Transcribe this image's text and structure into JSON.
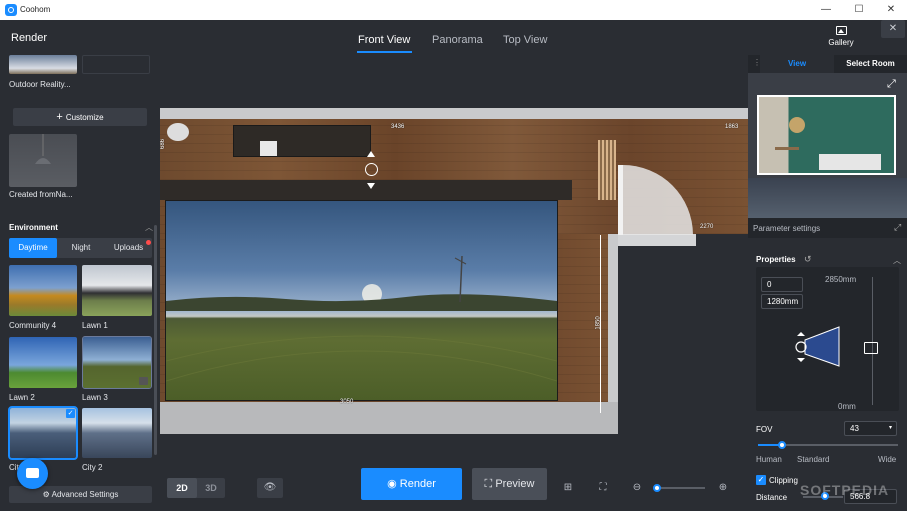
{
  "titlebar": {
    "title": "Coohom",
    "minimize": "—",
    "maximize": "☐",
    "close": "✕"
  },
  "header": {
    "title": "Render",
    "tabs": [
      {
        "label": "Front View"
      },
      {
        "label": "Panorama"
      },
      {
        "label": "Top View"
      }
    ],
    "gallery_label": "Gallery",
    "close": "✕"
  },
  "left": {
    "outdoor_label": "Outdoor Reality...",
    "customize_label": "Customize",
    "created_label": "Created fromNa...",
    "environment_title": "Environment",
    "env_tabs": [
      "Daytime",
      "Night",
      "Uploads"
    ],
    "thumbs": [
      {
        "label": "Community 4"
      },
      {
        "label": "Lawn 1"
      },
      {
        "label": "Lawn 2"
      },
      {
        "label": "Lawn 3"
      },
      {
        "label": "City 1"
      },
      {
        "label": "City 2"
      }
    ],
    "advanced_label": "Advanced Settings"
  },
  "plan": {
    "dims": [
      "3436",
      "1863",
      "2270",
      "1850",
      "3050",
      "686"
    ]
  },
  "bottom": {
    "btn_2d": "2D",
    "btn_3d": "3D",
    "render_label": "Render",
    "preview_label": "Preview"
  },
  "right": {
    "tabs": [
      "View",
      "Select Room"
    ],
    "param_title": "Parameter settings",
    "properties_title": "Properties",
    "field_angle": "0",
    "field_height": "1280mm",
    "top_label": "2850mm",
    "bottom_label": "0mm",
    "fov_label": "FOV",
    "fov_value": "43",
    "fov_level": 0.17,
    "lens_labels": [
      "Human",
      "Standard",
      "Wide"
    ],
    "clipping_label": "Clipping",
    "distance_label": "Distance",
    "distance_value": "566.8"
  },
  "watermark": "SOFTPEDIA",
  "colors": {
    "accent": "#1a8cff",
    "panel": "#2a2d33",
    "button": "#3a3e46"
  }
}
